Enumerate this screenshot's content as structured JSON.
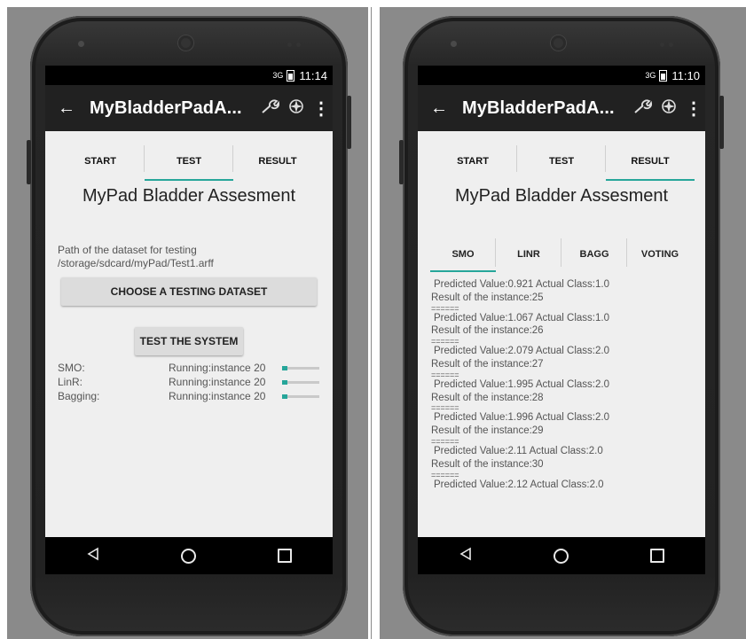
{
  "left_phone": {
    "status": {
      "signal": "3G",
      "time": "11:14"
    },
    "appbar": {
      "back_icon": "arrow-left-icon",
      "title": "MyBladderPadA...",
      "icons": [
        "wrench-icon",
        "compass-icon",
        "more-vert-icon"
      ]
    },
    "tabs": [
      {
        "label": "START"
      },
      {
        "label": "TEST"
      },
      {
        "label": "RESULT"
      }
    ],
    "active_tab": "TEST",
    "heading": "MyPad Bladder Assesment",
    "path_label": "Path of the dataset for testing",
    "path_value": "/storage/sdcard/myPad/Test1.arff",
    "choose_button": "CHOOSE A TESTING DATASET",
    "test_button": "TEST THE SYSTEM",
    "algorithms": [
      {
        "name": "SMO:",
        "status": "Running:instance 20",
        "progress": 0.15
      },
      {
        "name": "LinR:",
        "status": "Running:instance 20",
        "progress": 0.15
      },
      {
        "name": "Bagging:",
        "status": "Running:instance 20",
        "progress": 0.15
      }
    ]
  },
  "right_phone": {
    "status": {
      "signal": "3G",
      "time": "11:10"
    },
    "appbar": {
      "back_icon": "arrow-left-icon",
      "title": "MyBladderPadA...",
      "icons": [
        "wrench-icon",
        "compass-icon",
        "more-vert-icon"
      ]
    },
    "tabs": [
      {
        "label": "START"
      },
      {
        "label": "TEST"
      },
      {
        "label": "RESULT"
      }
    ],
    "active_tab": "RESULT",
    "heading": "MyPad Bladder Assesment",
    "sub_tabs": [
      {
        "label": "SMO"
      },
      {
        "label": "LINR"
      },
      {
        "label": "BAGG"
      },
      {
        "label": "VOTING"
      }
    ],
    "active_sub_tab": "SMO",
    "result_lines": [
      "Predicted Value:0.921 Actual Class:1.0",
      "Result of the instance:25",
      "======",
      "Predicted Value:1.067 Actual Class:1.0",
      "Result of the instance:26",
      "======",
      "Predicted Value:2.079 Actual Class:2.0",
      "Result of the instance:27",
      "======",
      "Predicted Value:1.995 Actual Class:2.0",
      "Result of the instance:28",
      "======",
      "Predicted Value:1.996 Actual Class:2.0",
      "Result of the instance:29",
      "======",
      "Predicted Value:2.11 Actual Class:2.0",
      "Result of the instance:30",
      "======",
      "Predicted Value:2.12 Actual Class:2.0"
    ]
  },
  "navbar_icons": [
    "back-triangle-icon",
    "home-circle-icon",
    "recents-square-icon"
  ],
  "colors": {
    "accent": "#26a69a",
    "appbar": "#212121",
    "screen_bg": "#efefef"
  }
}
